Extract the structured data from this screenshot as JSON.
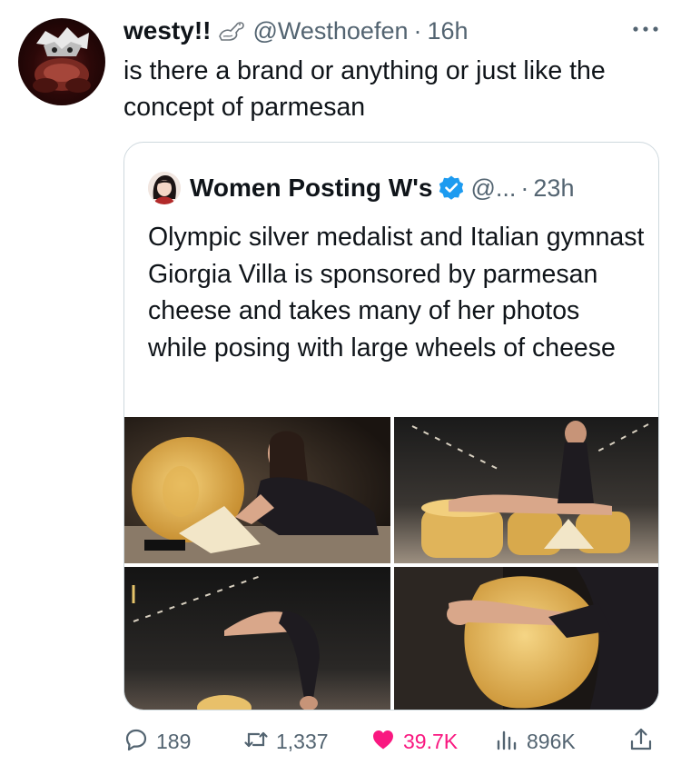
{
  "tweet": {
    "display_name": "westy!!",
    "handle": "@Westhoefen",
    "separator": "·",
    "time": "16h",
    "text": "is there a brand or anything or just like the concept of parmesan"
  },
  "quote": {
    "display_name": "Women Posting W's",
    "handle": "@...",
    "separator": "·",
    "time": "23h",
    "text": "Olympic silver medalist and Italian gymnast Giorgia Villa is sponsored by parmesan cheese and takes many of her photos while posing with large wheels of cheese",
    "media_count": 4
  },
  "actions": {
    "replies": "189",
    "retweets": "1,337",
    "likes": "39.7K",
    "views": "896K"
  },
  "colors": {
    "text": "#0f1419",
    "secondary": "#536471",
    "like": "#f91880",
    "verified": "#1d9bf0",
    "border": "#cfd9de"
  },
  "icons": [
    "more-icon",
    "verified-icon",
    "reply-icon",
    "retweet-icon",
    "like-icon",
    "views-icon",
    "share-icon"
  ]
}
